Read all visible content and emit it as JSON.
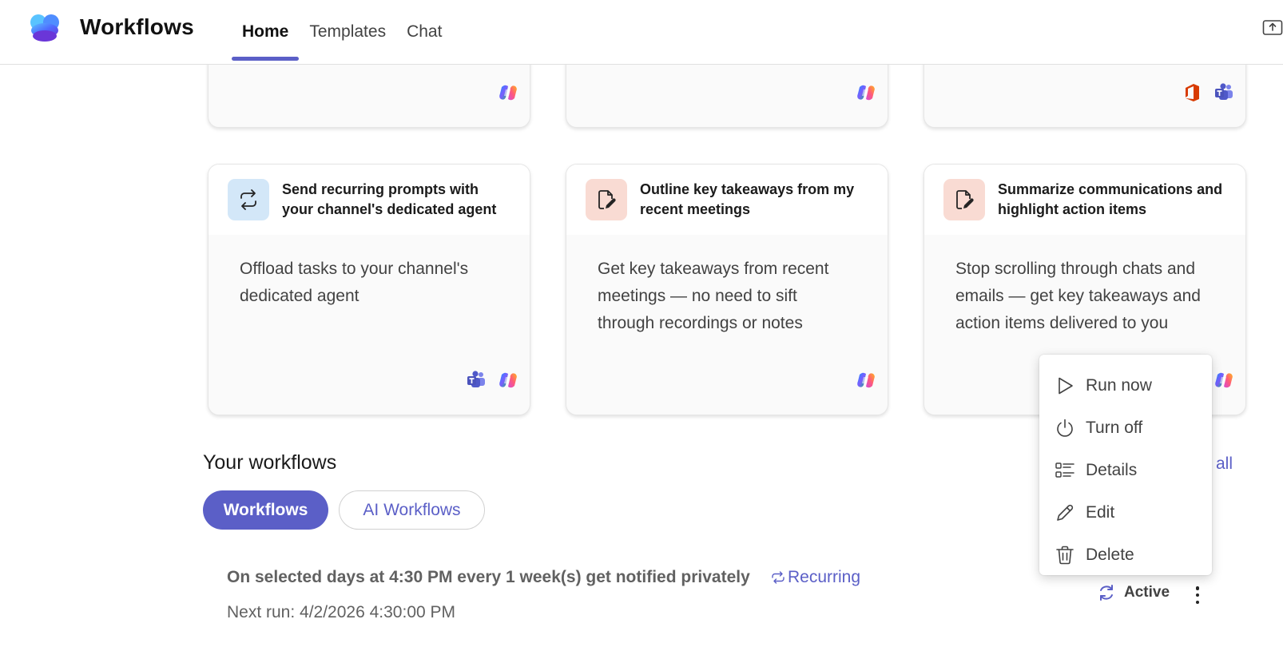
{
  "header": {
    "app_title": "Workflows",
    "tabs": [
      {
        "label": "Home",
        "active": true
      },
      {
        "label": "Templates",
        "active": false
      },
      {
        "label": "Chat",
        "active": false
      }
    ],
    "accent_color": "#5b5fc7"
  },
  "top_cards": [
    {
      "brands": [
        "copilot-icon"
      ]
    },
    {
      "brands": [
        "copilot-icon"
      ]
    },
    {
      "brands": [
        "office-icon",
        "teams-icon"
      ]
    }
  ],
  "cards": [
    {
      "title": "Send recurring prompts with your channel's dedicated agent",
      "description": "Offload tasks to your channel's dedicated agent",
      "icon": "repeat-icon",
      "brands": [
        "teams-icon",
        "copilot-icon"
      ]
    },
    {
      "title": "Outline key takeaways from my recent meetings",
      "description": "Get key takeaways from recent meetings — no need to sift through recordings or notes",
      "icon": "document-edit-icon",
      "brands": [
        "copilot-icon"
      ]
    },
    {
      "title": "Summarize communications and highlight action items",
      "description": "Stop scrolling through chats and emails — get key takeaways and action items delivered to you",
      "icon": "document-edit-icon",
      "brands": [
        "copilot-icon"
      ]
    }
  ],
  "section": {
    "title": "Your workflows",
    "see_all_partial": "all",
    "pills": [
      {
        "label": "Workflows",
        "active": true
      },
      {
        "label": "AI Workflows",
        "active": false
      }
    ]
  },
  "workflow": {
    "title": "On selected days at 4:30 PM every 1 week(s) get notified privately",
    "recurring_label": "Recurring",
    "next_run": "Next run: 4/2/2026 4:30:00 PM",
    "status": "Active"
  },
  "context_menu": {
    "items": [
      {
        "label": "Run now",
        "icon": "play-icon"
      },
      {
        "label": "Turn off",
        "icon": "power-icon"
      },
      {
        "label": "Details",
        "icon": "details-list-icon"
      },
      {
        "label": "Edit",
        "icon": "pencil-icon"
      },
      {
        "label": "Delete",
        "icon": "trash-icon"
      }
    ]
  }
}
